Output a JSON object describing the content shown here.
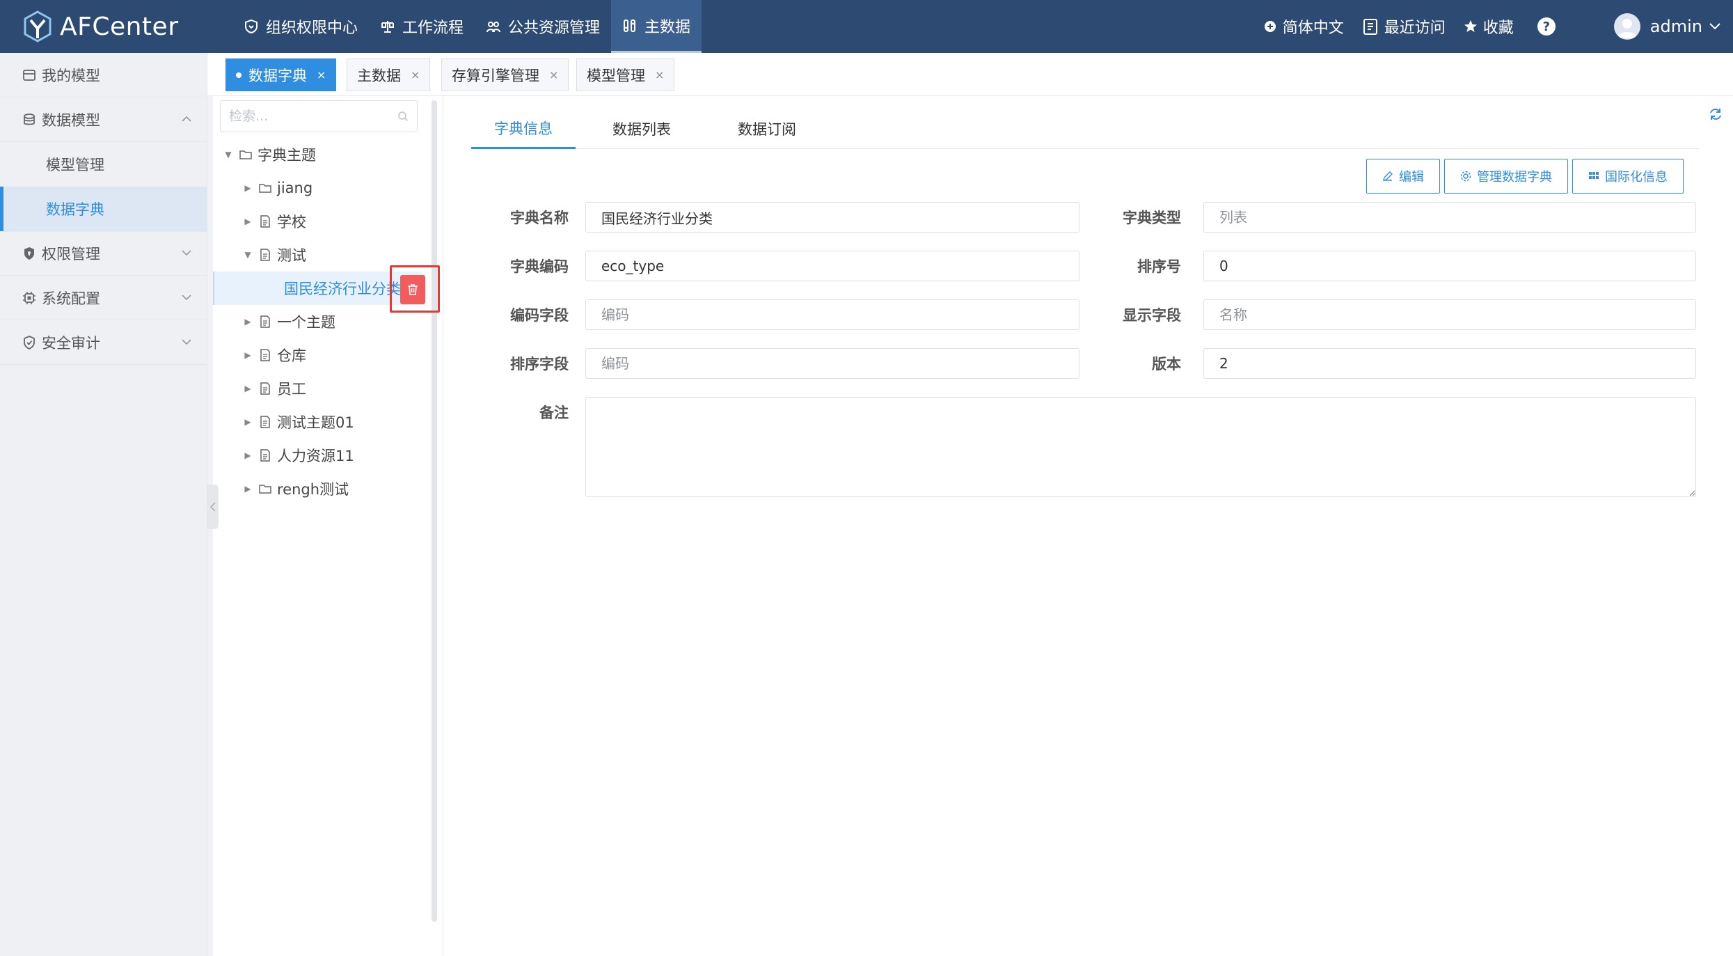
{
  "app": {
    "title": "AFCenter",
    "accent_color": "#2f8ee0",
    "header_color": "#2d4a72"
  },
  "topnav": [
    {
      "label": "组织权限中心",
      "icon": "shield-heart-icon"
    },
    {
      "label": "工作流程",
      "icon": "workflow-icon"
    },
    {
      "label": "公共资源管理",
      "icon": "people-icon"
    },
    {
      "label": "主数据",
      "icon": "master-data-icon"
    }
  ],
  "topnav_active": "主数据",
  "topright": {
    "language": "简体中文",
    "recent": "最近访问",
    "favorites": "收藏",
    "help": "?",
    "username": "admin"
  },
  "sidebar": {
    "items": [
      {
        "label": "我的模型",
        "icon": "model-icon"
      },
      {
        "label": "数据模型",
        "icon": "database-icon",
        "expanded": true,
        "children": [
          {
            "label": "模型管理"
          },
          {
            "label": "数据字典",
            "active": true
          }
        ]
      },
      {
        "label": "权限管理",
        "icon": "lock-shield-icon"
      },
      {
        "label": "系统配置",
        "icon": "chip-icon"
      },
      {
        "label": "安全审计",
        "icon": "audit-shield-icon"
      }
    ]
  },
  "page_tabs": [
    {
      "label": "数据字典",
      "active": true
    },
    {
      "label": "主数据"
    },
    {
      "label": "存算引擎管理"
    },
    {
      "label": "模型管理"
    }
  ],
  "tree": {
    "search_placeholder": "检索...",
    "nodes": [
      {
        "label": "字典主题",
        "icon": "folder-icon",
        "expanded": true
      },
      {
        "label": "jiang",
        "icon": "folder-icon"
      },
      {
        "label": "学校",
        "icon": "document-icon"
      },
      {
        "label": "测试",
        "icon": "document-icon",
        "expanded": true
      },
      {
        "label": "国民经济行业分类",
        "selected": true
      },
      {
        "label": "一个主题",
        "icon": "document-icon"
      },
      {
        "label": "仓库",
        "icon": "document-icon"
      },
      {
        "label": "员工",
        "icon": "document-icon"
      },
      {
        "label": "测试主题01",
        "icon": "document-icon"
      },
      {
        "label": "人力资源11",
        "icon": "document-icon"
      },
      {
        "label": "rengh测试",
        "icon": "folder-icon"
      }
    ]
  },
  "detail": {
    "tabs": [
      {
        "label": "字典信息",
        "active": true
      },
      {
        "label": "数据列表"
      },
      {
        "label": "数据订阅"
      }
    ],
    "actions": {
      "edit": "编辑",
      "manage": "管理数据字典",
      "i18n": "国际化信息"
    },
    "form": {
      "name_label": "字典名称",
      "name_value": "国民经济行业分类",
      "type_label": "字典类型",
      "type_placeholder": "列表",
      "code_label": "字典编码",
      "code_value": "eco_type",
      "order_label": "排序号",
      "order_value": "0",
      "code_field_label": "编码字段",
      "code_field_placeholder": "编码",
      "display_field_label": "显示字段",
      "display_field_placeholder": "名称",
      "sort_field_label": "排序字段",
      "sort_field_placeholder": "编码",
      "version_label": "版本",
      "version_value": "2",
      "remark_label": "备注",
      "remark_value": ""
    }
  }
}
